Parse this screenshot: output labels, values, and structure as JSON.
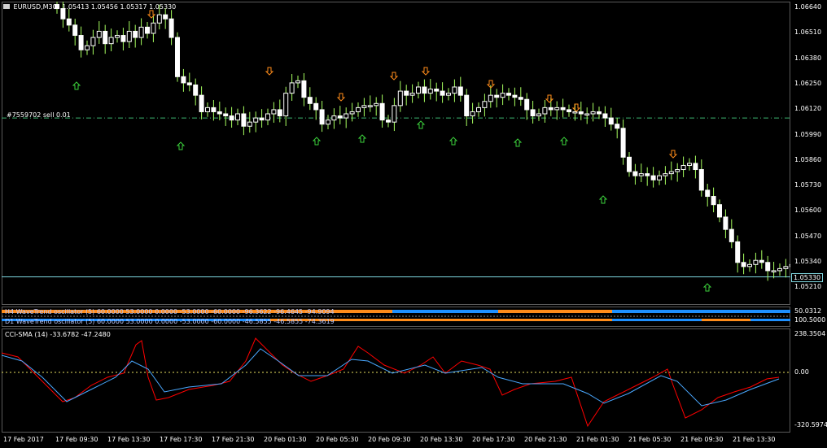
{
  "header": {
    "symbol": "EURUSD,M30",
    "ohlc": "1.05413 1.05456 1.05317 1.05330"
  },
  "order_line": {
    "label": "#7559702 sell 0.01",
    "price": 1.061
  },
  "current_price": "1.05330",
  "price_axis": [
    "1.06640",
    "1.06510",
    "1.06380",
    "1.06250",
    "1.06120",
    "1.05990",
    "1.05860",
    "1.05730",
    "1.05600",
    "1.05470",
    "1.05340",
    "1.05210"
  ],
  "indicators": {
    "h4_label": "H4 WaveTrend oscillator (5) 60.0000 53.0000 0.0000 -53.0000 -60.0000 -96.3622 -96.4645 -94.9094",
    "d1_label": "D1 WaveTrend oscillator (5) 60.0000 53.0000 0.0000 -53.0000 -60.0000 -46.5855 -46.5855 -74.3619",
    "h4_axis": "50.0312",
    "d1_axis": "100.5000",
    "cci_label": "CCI-SMA (14) -33.6782 -47.2480",
    "cci_max": "238.3504",
    "cci_zero": "0.00",
    "cci_min": "-320.5974"
  },
  "time_axis": [
    "17 Feb 2017",
    "17 Feb 09:30",
    "17 Feb 13:30",
    "17 Feb 17:30",
    "17 Feb 21:30",
    "20 Feb 01:30",
    "20 Feb 05:30",
    "20 Feb 09:30",
    "20 Feb 13:30",
    "20 Feb 17:30",
    "20 Feb 21:30",
    "21 Feb 01:30",
    "21 Feb 05:30",
    "21 Feb 09:30",
    "21 Feb 13:30"
  ],
  "colors": {
    "bull": "#ffffff",
    "bear": "#e0ff90",
    "wick": "#a8ff60",
    "down_arrow": "#ff8c1a",
    "up_arrow": "#3cd23c",
    "cci_red": "#ff0000",
    "cci_blue": "#4aa8ff",
    "order": "#3cb371",
    "price_line": "#7fd7e0"
  },
  "chart_data": {
    "type": "candlestick",
    "ylim": [
      1.0521,
      1.0664
    ],
    "candles_close": [
      1.0663,
      1.0658,
      1.0655,
      1.065,
      1.0643,
      1.0645,
      1.0649,
      1.0652,
      1.0646,
      1.0649,
      1.065,
      1.0647,
      1.0652,
      1.0649,
      1.0654,
      1.0651,
      1.0656,
      1.066,
      1.0658,
      1.0649,
      1.063,
      1.0627,
      1.0626,
      1.0621,
      1.0613,
      1.0615,
      1.0613,
      1.0612,
      1.0611,
      1.0609,
      1.0612,
      1.0606,
      1.0608,
      1.061,
      1.0609,
      1.0612,
      1.0614,
      1.0611,
      1.0622,
      1.0627,
      1.0628,
      1.062,
      1.0617,
      1.0614,
      1.0607,
      1.0609,
      1.0611,
      1.061,
      1.0612,
      1.0613,
      1.0615,
      1.0616,
      1.0616,
      1.0617,
      1.0609,
      1.0608,
      1.0616,
      1.0623,
      1.0621,
      1.0622,
      1.0625,
      1.0622,
      1.0624,
      1.0623,
      1.0621,
      1.0622,
      1.0625,
      1.0621,
      1.0611,
      1.0613,
      1.0615,
      1.0618,
      1.0621,
      1.062,
      1.0622,
      1.0621,
      1.062,
      1.0619,
      1.0614,
      1.0611,
      1.0612,
      1.0615,
      1.0614,
      1.0615,
      1.0614,
      1.0613,
      1.0613,
      1.0612,
      1.0612,
      1.0613,
      1.0612,
      1.061,
      1.0607,
      1.0605,
      1.0591,
      1.0584,
      1.0582,
      1.0583,
      1.0582,
      1.058,
      1.0582,
      1.0583,
      1.0584,
      1.0585,
      1.0587,
      1.0588,
      1.0585,
      1.0575,
      1.0572,
      1.0568,
      1.0562,
      1.0556,
      1.055,
      1.054,
      1.0538,
      1.0539,
      1.0541,
      1.054,
      1.0536,
      1.0536,
      1.0537,
      1.0538,
      1.0539,
      1.0537,
      1.054,
      1.0533
    ]
  }
}
